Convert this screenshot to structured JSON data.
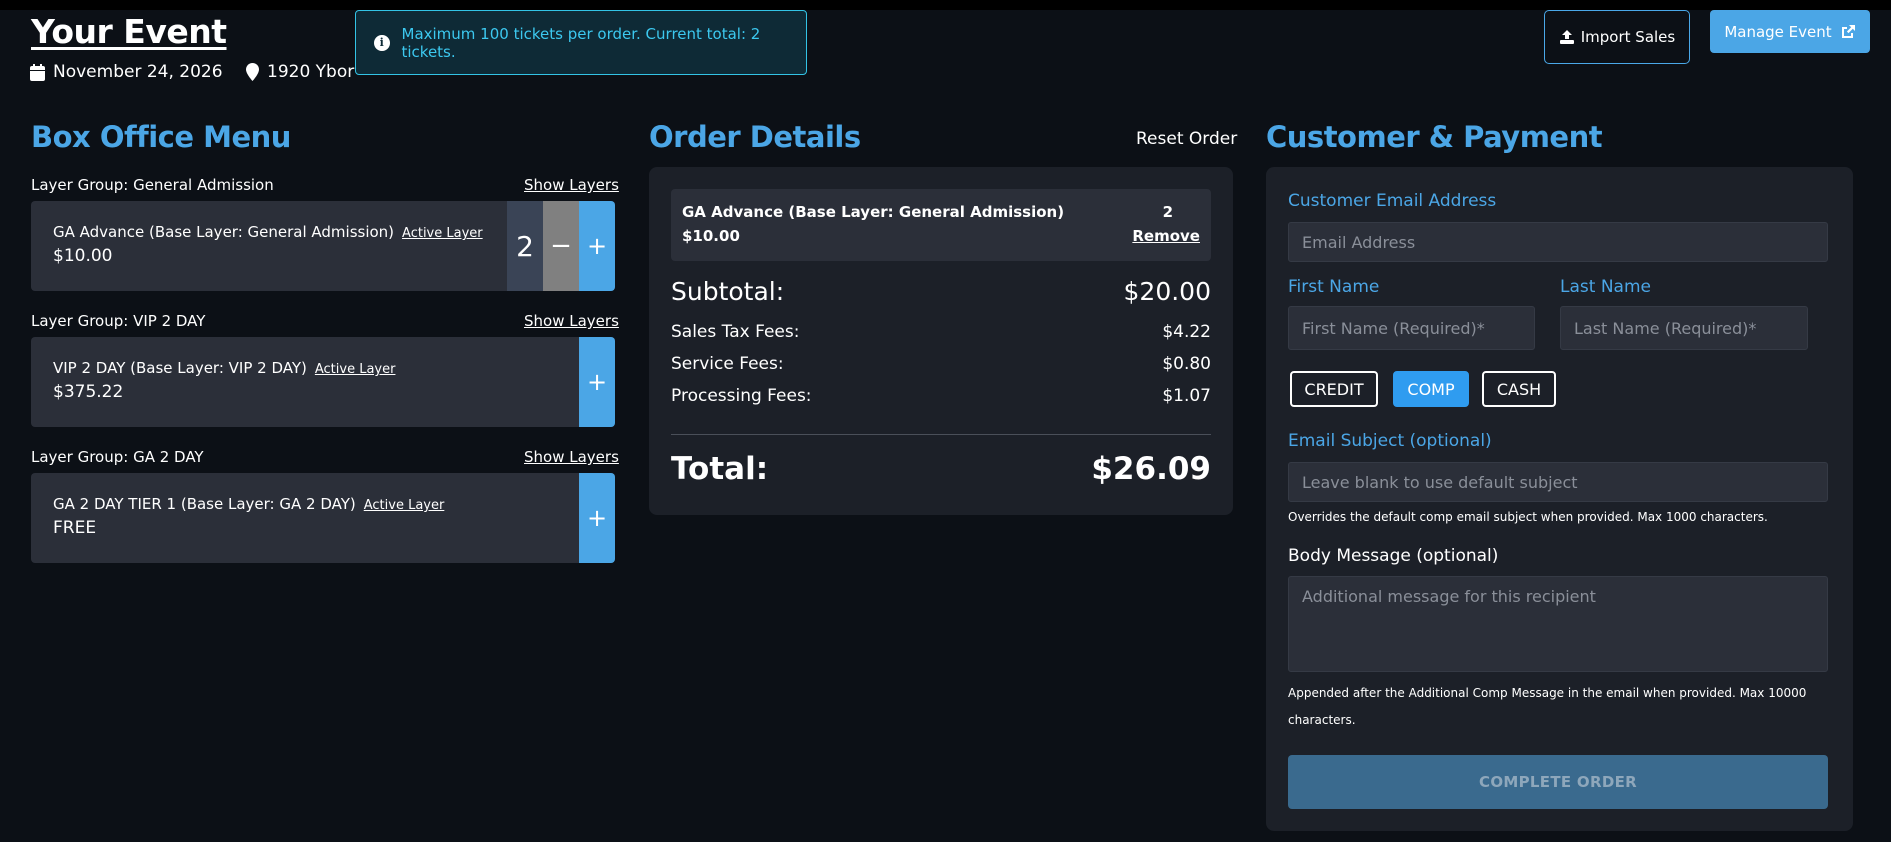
{
  "header": {
    "title": "Your Event",
    "date": "November 24, 2026",
    "venue": "1920 Ybor",
    "alert": "Maximum 100 tickets per order. Current total: 2 tickets.",
    "import_label": "Import Sales",
    "manage_label": "Manage Event"
  },
  "box_office": {
    "title": "Box Office Menu",
    "show_layers_label": "Show Layers",
    "groups": [
      {
        "label": "Layer Group: General Admission",
        "ticket": "GA Advance (Base Layer: General Admission)",
        "active": "Active Layer",
        "price": "$10.00",
        "qty": "2",
        "minus": "−",
        "plus": "+"
      },
      {
        "label": "Layer Group: VIP 2 DAY",
        "ticket": "VIP 2 DAY (Base Layer: VIP 2 DAY)",
        "active": "Active Layer",
        "price": "$375.22",
        "plus": "+"
      },
      {
        "label": "Layer Group: GA 2 DAY",
        "ticket": "GA 2 DAY TIER 1 (Base Layer: GA 2 DAY)",
        "active": "Active Layer",
        "price": "FREE",
        "plus": "+"
      }
    ]
  },
  "order": {
    "title": "Order Details",
    "reset_label": "Reset Order",
    "line": {
      "name": "GA Advance (Base Layer: General Admission)",
      "price": "$10.00",
      "qty": "2",
      "remove": "Remove"
    },
    "subtotal_label": "Subtotal:",
    "subtotal": "$20.00",
    "tax_label": "Sales Tax Fees:",
    "tax": "$4.22",
    "service_label": "Service Fees:",
    "service": "$0.80",
    "processing_label": "Processing Fees:",
    "processing": "$1.07",
    "total_label": "Total:",
    "total": "$26.09"
  },
  "customer": {
    "title": "Customer & Payment",
    "email_label": "Customer Email Address",
    "email_placeholder": "Email Address",
    "first_label": "First Name",
    "first_placeholder": "First Name (Required)*",
    "last_label": "Last Name",
    "last_placeholder": "Last Name (Required)*",
    "pay_methods": [
      "CREDIT",
      "COMP",
      "CASH"
    ],
    "active_method": "COMP",
    "subject_label": "Email Subject (optional)",
    "subject_placeholder": "Leave blank to use default subject",
    "subject_hint": "Overrides the default comp email subject when provided. Max 1000 characters.",
    "body_label": "Body Message (optional)",
    "body_placeholder": "Additional message for this recipient",
    "body_hint": "Appended after the Additional Comp Message in the email when provided. Max 10000 characters.",
    "complete_label": "COMPLETE ORDER"
  },
  "colors": {
    "accent": "#4ba6e6",
    "background": "#0c1016",
    "panel": "#1c2028",
    "card": "#2b2f39",
    "alert": "#33c4e6"
  }
}
